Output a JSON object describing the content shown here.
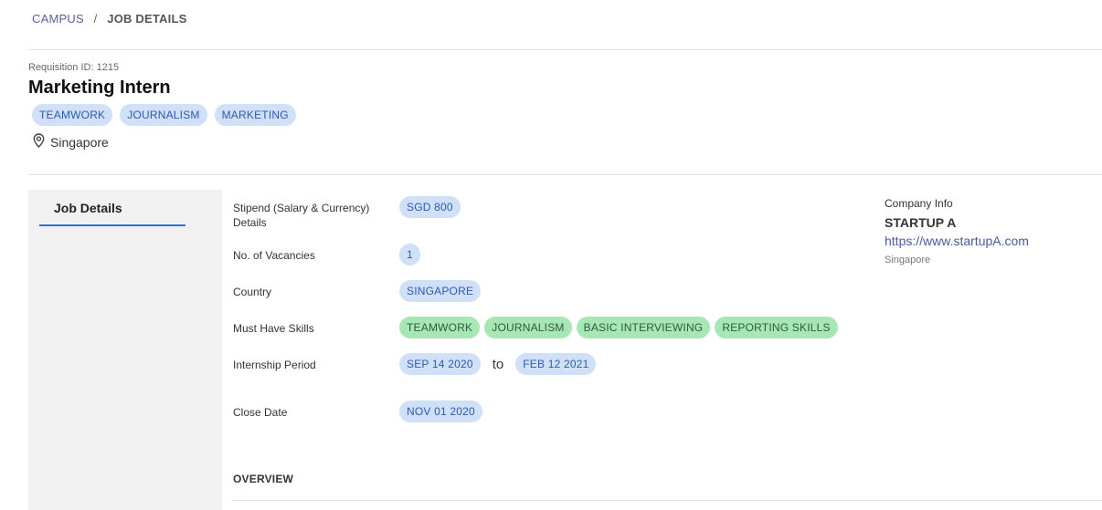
{
  "breadcrumb": {
    "root": "CAMPUS",
    "separator": "/",
    "current": "JOB DETAILS"
  },
  "job": {
    "requisition": "Requisition ID: 1215",
    "title": "Marketing Intern",
    "tags": [
      "TEAMWORK",
      "JOURNALISM",
      "MARKETING"
    ],
    "location": "Singapore",
    "location_icon": "map-pin-icon"
  },
  "sidebar": {
    "tab_label": "Job Details"
  },
  "details": {
    "stipend_label": "Stipend (Salary & Currency) Details",
    "stipend_value": "SGD 800",
    "vacancies_label": "No. of Vacancies",
    "vacancies_value": "1",
    "country_label": "Country",
    "country_value": "SINGAPORE",
    "skills_label": "Must Have Skills",
    "skills": [
      "TEAMWORK",
      "JOURNALISM",
      "BASIC INTERVIEWING",
      "REPORTING SKILLS"
    ],
    "period_label": "Internship Period",
    "period_start": "SEP 14 2020",
    "period_to": "to",
    "period_end": "FEB 12 2021",
    "close_label": "Close Date",
    "close_value": "NOV 01 2020"
  },
  "company": {
    "label": "Company Info",
    "name": "STARTUP A",
    "url": "https://www.startupA.com",
    "location": "Singapore"
  },
  "overview": {
    "heading": "OVERVIEW"
  },
  "colors": {
    "chip_blue": "#cfe0f8",
    "chip_green": "#a7e6b5",
    "tab_underline": "#2c6fd6"
  }
}
